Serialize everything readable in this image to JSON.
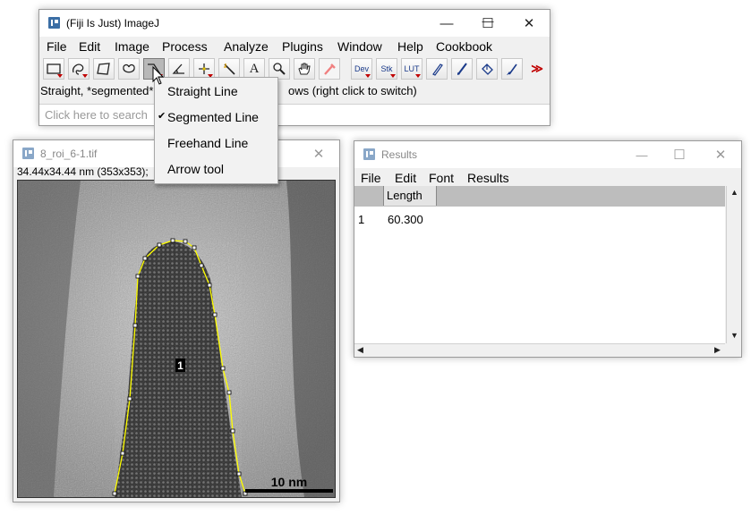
{
  "imagej": {
    "title": "(Fiji Is Just) ImageJ",
    "menu": [
      "File",
      "Edit",
      "Image",
      "Process",
      "Analyze",
      "Plugins",
      "Window",
      "Help",
      "Cookbook"
    ],
    "tools": {
      "dev": "Dev",
      "stk": "Stk",
      "lut": "LUT",
      "text": "A",
      "more": "≫"
    },
    "status_left": "Straight, *segmented*",
    "status_right": "ows (right click to switch)",
    "search_placeholder": "Click here to search"
  },
  "line_popup": {
    "items": [
      {
        "label": "Straight Line",
        "checked": false
      },
      {
        "label": "Segmented Line",
        "checked": true
      },
      {
        "label": "Freehand Line",
        "checked": false
      },
      {
        "label": "Arrow tool",
        "checked": false
      }
    ],
    "check_glyph": "✔"
  },
  "image_window": {
    "title": "8_roi_6-1.tif",
    "info": "34.44x34.44 nm (353x353);",
    "roi_label": "1",
    "scale_bar_label": "10 nm"
  },
  "results": {
    "title": "Results",
    "menu": [
      "File",
      "Edit",
      "Font",
      "Results"
    ],
    "columns": [
      "",
      "Length"
    ],
    "rows": [
      {
        "index": "1",
        "length": "60.300"
      }
    ]
  },
  "window_controls": {
    "minimize": "—",
    "maximize": "☐",
    "close": "✕"
  },
  "colors": {
    "roi": "#ffff00",
    "active_tool": "#b8b8b8",
    "arrow_red": "#c00000"
  }
}
